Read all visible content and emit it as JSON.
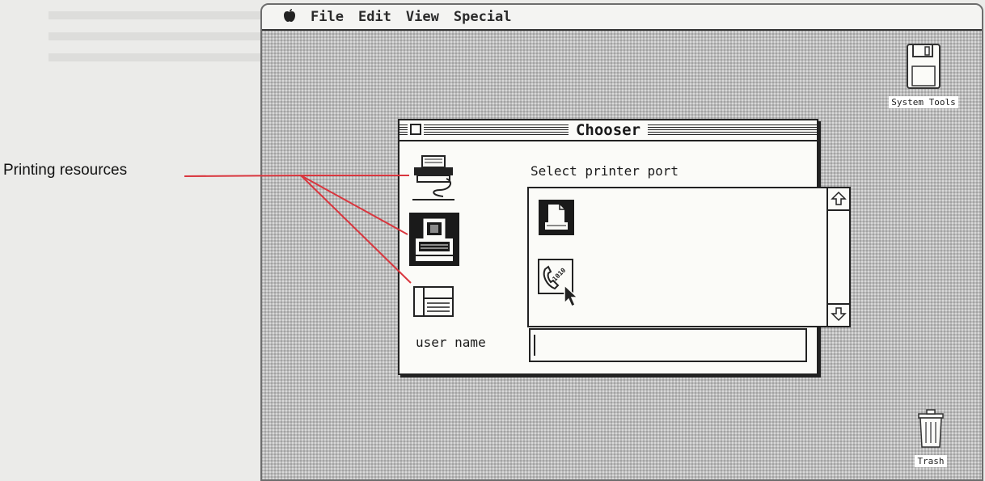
{
  "menubar": {
    "apple_icon": "apple-icon",
    "items": [
      {
        "label": "File"
      },
      {
        "label": "Edit"
      },
      {
        "label": "View"
      },
      {
        "label": "Special"
      }
    ]
  },
  "desktop": {
    "disk_label": "System Tools",
    "trash_label": "Trash"
  },
  "chooser": {
    "title": "Chooser",
    "printer_types": [
      {
        "icon": "imagewriter-icon"
      },
      {
        "icon": "laserwriter-icon",
        "selected": true
      },
      {
        "icon": "daisywheel-printer-icon"
      }
    ],
    "port_label": "Select printer port",
    "ports": [
      {
        "icon": "printer-port-icon",
        "selected": true
      },
      {
        "icon": "modem-port-icon"
      }
    ],
    "username_label": "user name",
    "username_value": ""
  },
  "callout": {
    "label": "Printing resources"
  },
  "colors": {
    "callout_line": "#d9363e",
    "desktop_gray": "#bcbcbc",
    "window_bg": "#fbfbf8"
  }
}
